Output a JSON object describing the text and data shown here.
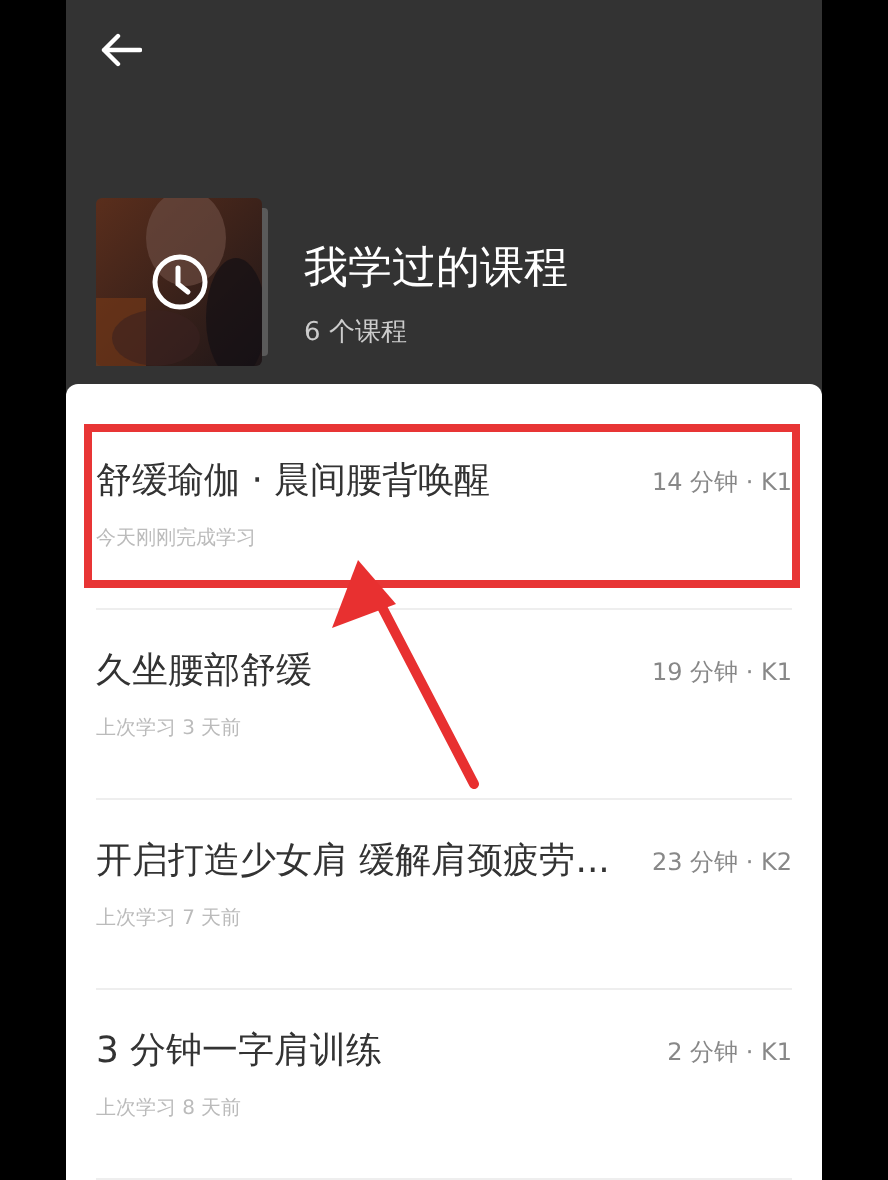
{
  "header": {
    "title": "我学过的课程",
    "count": "6 个课程"
  },
  "courses": [
    {
      "title": "舒缓瑜伽 · 晨间腰背唤醒",
      "meta": "14 分钟 · K1",
      "last_study": "今天刚刚完成学习",
      "highlighted": true
    },
    {
      "title": "久坐腰部舒缓",
      "meta": "19 分钟 · K1",
      "last_study": "上次学习 3 天前",
      "highlighted": false
    },
    {
      "title": "开启打造少女肩 缓解肩颈疲劳...",
      "meta": "23 分钟 · K2",
      "last_study": "上次学习 7 天前",
      "highlighted": false
    },
    {
      "title": "3 分钟一字肩训练",
      "meta": "2 分钟 · K1",
      "last_study": "上次学习 8 天前",
      "highlighted": false
    }
  ]
}
